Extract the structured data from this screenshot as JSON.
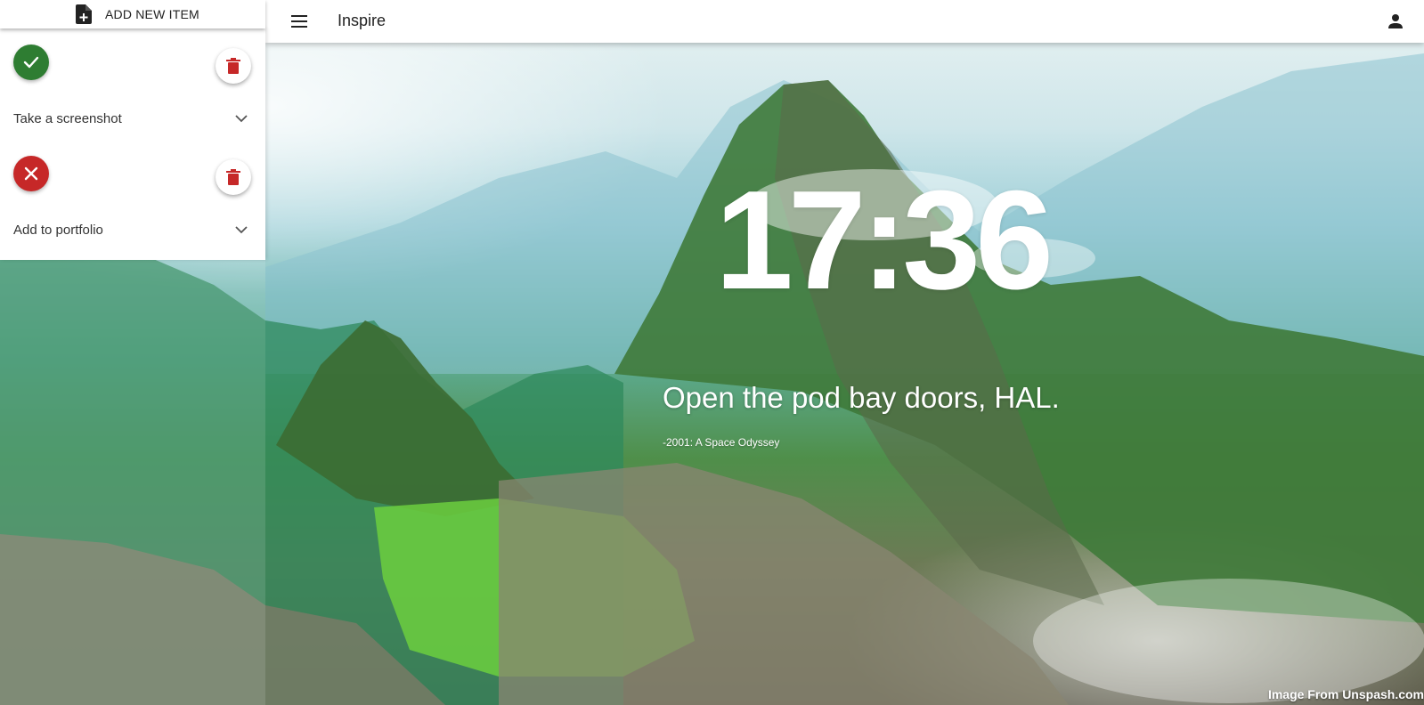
{
  "app": {
    "title": "Inspire"
  },
  "sidebar": {
    "add_item_label": "ADD NEW ITEM",
    "tasks": [
      {
        "title": "Take a screenshot",
        "status": "done",
        "status_icon": "check-icon",
        "delete_icon": "trash-icon",
        "expand_icon": "chevron-down-icon"
      },
      {
        "title": "Add to portfolio",
        "status": "failed",
        "status_icon": "close-icon",
        "delete_icon": "trash-icon",
        "expand_icon": "chevron-down-icon"
      }
    ]
  },
  "main": {
    "time": "17:36",
    "quote": "Open the pod bay doors, HAL.",
    "quote_source": "-2001: A Space Odyssey",
    "image_credit": "Image From Unspash.com"
  },
  "colors": {
    "success": "#2e7d32",
    "error": "#c62828",
    "delete_icon": "#c62828",
    "topbar": "#ffffff"
  },
  "icons": {
    "menu": "hamburger-menu-icon",
    "account": "person-icon",
    "add_item": "note-add-icon"
  }
}
